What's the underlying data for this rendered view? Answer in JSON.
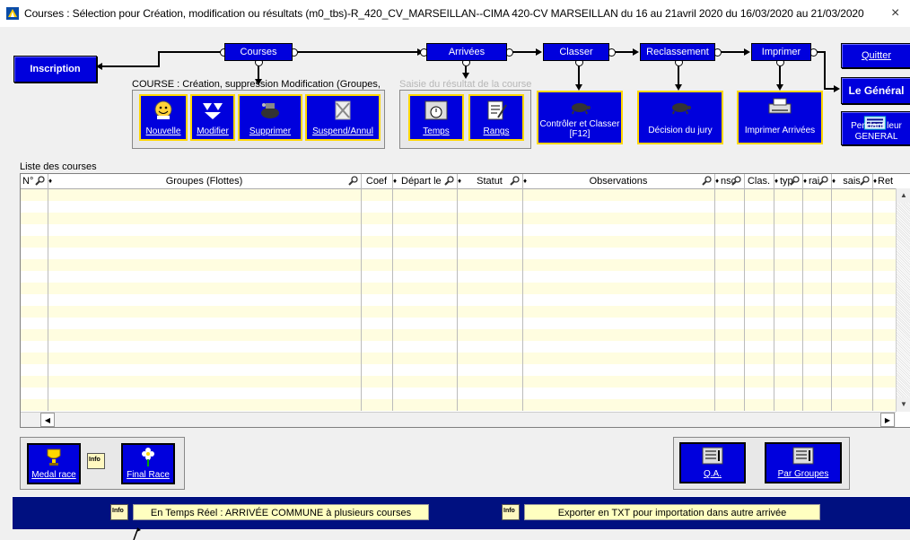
{
  "window": {
    "title": "Courses : Sélection pour Création, modification ou résultats   (m0_tbs)-R_420_CV_MARSEILLAN--CIMA 420-CV MARSEILLAN du 16 au 21avril 2020 du 16/03/2020 au 21/03/2020",
    "close": "×"
  },
  "buttons": {
    "inscription": "Inscription",
    "quitter": "Quitter",
    "le_general": "Le Général",
    "pendant_general": "Pendant leur GENERAL"
  },
  "workflow": {
    "courses": "Courses",
    "arrivees": "Arrivées",
    "classer": "Classer",
    "reclassement": "Reclassement",
    "imprimer": "Imprimer"
  },
  "course_group": {
    "label": "COURSE : Création, suppression Modification (Groupes,",
    "nouvelle": "Nouvelle",
    "modifier": "Modifier",
    "supprimer": "Supprimer",
    "suspend": "Suspend/Annul"
  },
  "saisie_group": {
    "label": "Saisie du résultat de la course",
    "temps": "Temps",
    "rangs": "Rangs"
  },
  "actions": {
    "controler": "Contrôler et Classer [F12]",
    "decision": "Décision du jury",
    "imprimer_arrivees": "Imprimer Arrivées"
  },
  "list": {
    "title": "Liste des courses",
    "columns": [
      "N°",
      "Groupes (Flottes)",
      "Coef",
      "Départ le",
      "Statut",
      "Observations",
      "nsc",
      "Clas.",
      "typ",
      "rai",
      "sais",
      "Ret"
    ]
  },
  "bottom_buttons": {
    "medal_race": "Medal race",
    "final_race": "Final Race",
    "qa": "Q.A.",
    "par_groupes": "Par Groupes"
  },
  "statusbar": {
    "temps_reel": "En Temps Réel : ARRIVÉE COMMUNE à plusieurs courses",
    "exporter": "Exporter  en TXT pour importation dans  autre arrivée"
  },
  "colors": {
    "accent_blue": "#0000dd",
    "bottombar": "#001080",
    "row_alt": "#fffde0",
    "btn_border": "#ffd700"
  }
}
